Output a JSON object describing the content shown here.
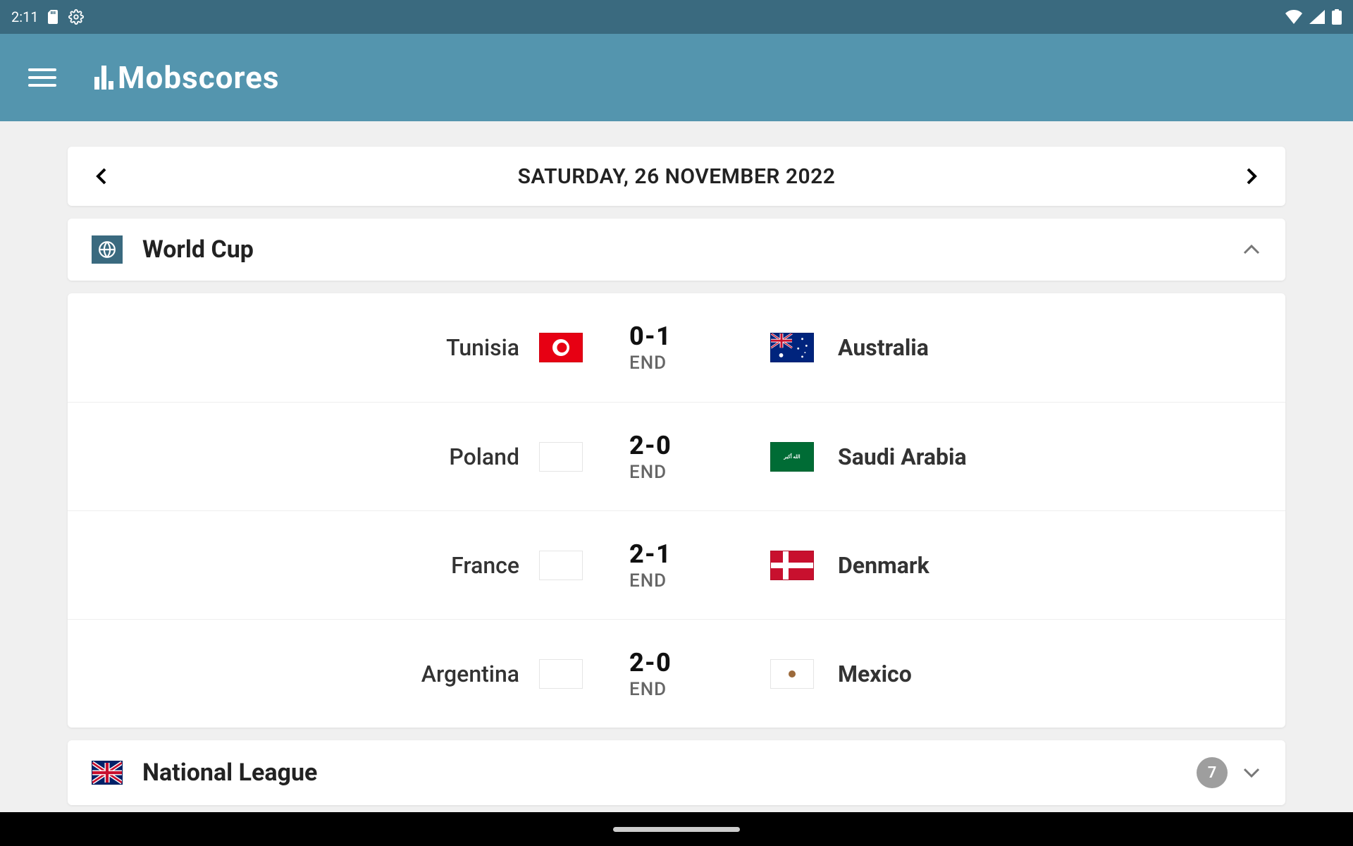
{
  "statusbar": {
    "time": "2:11"
  },
  "app": {
    "name": "Mobscores"
  },
  "dateNav": {
    "date": "SATURDAY, 26 NOVEMBER 2022"
  },
  "sections": [
    {
      "title": "World Cup",
      "expanded": true,
      "matches": [
        {
          "home": "Tunisia",
          "homeFlag": "tn",
          "away": "Australia",
          "awayFlag": "au",
          "score": "0-1",
          "status": "END"
        },
        {
          "home": "Poland",
          "homeFlag": "pl",
          "away": "Saudi Arabia",
          "awayFlag": "sa",
          "score": "2-0",
          "status": "END"
        },
        {
          "home": "France",
          "homeFlag": "fr",
          "away": "Denmark",
          "awayFlag": "dk",
          "score": "2-1",
          "status": "END"
        },
        {
          "home": "Argentina",
          "homeFlag": "ar",
          "away": "Mexico",
          "awayFlag": "mx",
          "score": "2-0",
          "status": "END"
        }
      ]
    },
    {
      "title": "National League",
      "expanded": false,
      "count": "7"
    }
  ]
}
